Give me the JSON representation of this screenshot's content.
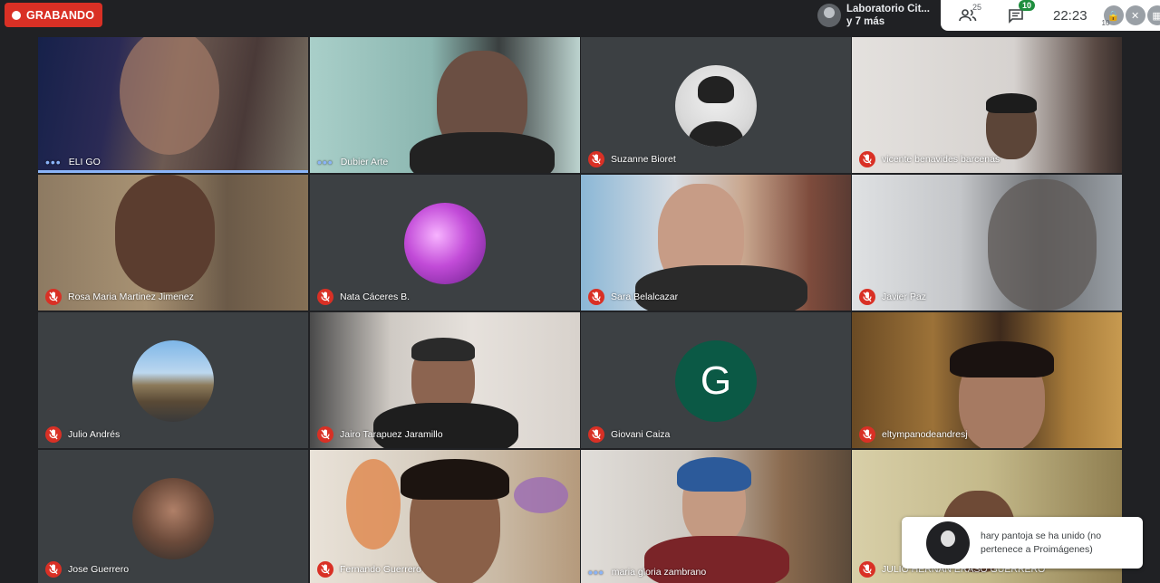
{
  "recording": {
    "label": "GRABANDO"
  },
  "presenter": {
    "line1": "Laboratorio Cit...",
    "line2": "y 7 más"
  },
  "topbar": {
    "people_icon": "people-icon",
    "people_count": "25",
    "chat_icon": "chat-icon",
    "chat_count": "10",
    "time": "22:23",
    "extra_count": "10"
  },
  "tiles": [
    {
      "name": "ELI GO",
      "status": "speaking"
    },
    {
      "name": "Dubier Arte",
      "status": "speaking"
    },
    {
      "name": "Suzanne Bioret",
      "status": "muted"
    },
    {
      "name": "vicente benavides barcenas",
      "status": "muted"
    },
    {
      "name": "Rosa Maria Martinez Jimenez",
      "status": "muted"
    },
    {
      "name": "Nata Cáceres B.",
      "status": "muted"
    },
    {
      "name": "Sara Belalcazar",
      "status": "muted"
    },
    {
      "name": "Javier Paz",
      "status": "muted"
    },
    {
      "name": "Julio Andrés",
      "status": "muted"
    },
    {
      "name": "Jairo Tarapuez Jaramillo",
      "status": "muted"
    },
    {
      "name": "Giovani Caiza",
      "status": "muted",
      "initial": "G"
    },
    {
      "name": "eltympanodeandresj",
      "status": "muted"
    },
    {
      "name": "Jose Guerrero",
      "status": "muted"
    },
    {
      "name": "Fernando Guerrero",
      "status": "muted"
    },
    {
      "name": "maria gloria zambrano",
      "status": "speaking"
    },
    {
      "name": "JULIO HERNAN ERASO GUERRERO",
      "status": "muted"
    }
  ],
  "toast": {
    "message": "hary pantoja se ha unido (no pertenece a Proimágenes)"
  },
  "colors": {
    "mute_red": "#d93025",
    "speaking_blue": "#8ab4f8",
    "giovani_avatar": "#0b5945"
  }
}
